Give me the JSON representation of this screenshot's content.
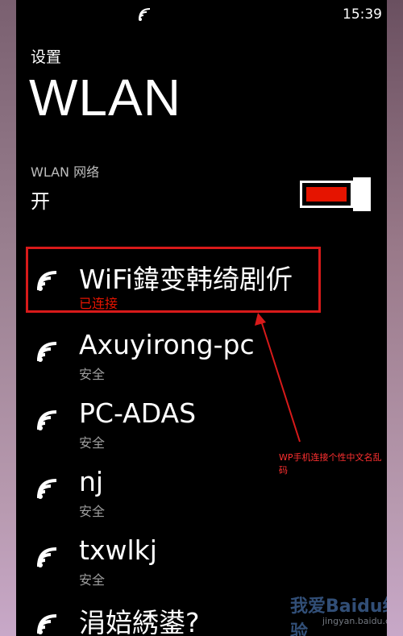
{
  "status": {
    "time": "15:39"
  },
  "header": {
    "app": "设置",
    "title": "WLAN"
  },
  "wlan": {
    "label": "WLAN 网络",
    "state": "开",
    "enabled": true,
    "accent": "#e51400"
  },
  "networks": [
    {
      "name": "WiFi鍏变韩绮剧伒",
      "status": "已连接",
      "icon": "wifi-signal-icon"
    },
    {
      "name": "Axuyirong-pc",
      "status": "安全",
      "icon": "wifi-signal-icon"
    },
    {
      "name": "PC-ADAS",
      "status": "安全",
      "icon": "wifi-signal-icon"
    },
    {
      "name": "nj",
      "status": "安全",
      "icon": "wifi-signal-icon"
    },
    {
      "name": "txwlkj",
      "status": "安全",
      "icon": "wifi-signal-icon"
    },
    {
      "name": "涓婄綉鍙?",
      "status": "",
      "icon": "wifi-signal-icon"
    }
  ],
  "annotation": {
    "text": "WP手机连接个性中文名乱码",
    "color": "#ff3030"
  },
  "watermark": {
    "text": "我爱Baidu经验",
    "url": "jingyan.baidu.com"
  }
}
